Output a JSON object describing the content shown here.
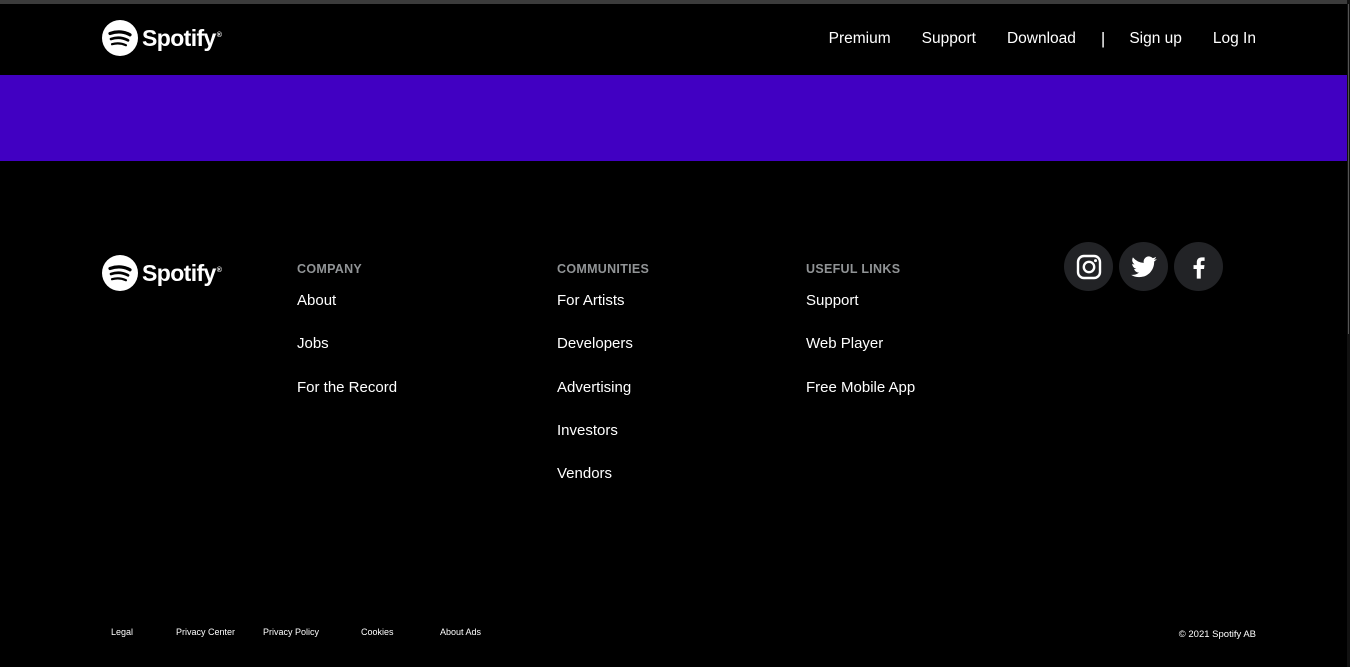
{
  "brand": {
    "name": "Spotify",
    "tm": "®"
  },
  "nav": {
    "links": [
      "Premium",
      "Support",
      "Download"
    ],
    "divider": "|",
    "signup": "Sign up",
    "login": "Log In"
  },
  "banner": {
    "color": "#4100c2"
  },
  "footer": {
    "company": {
      "heading": "COMPANY",
      "links": [
        "About",
        "Jobs",
        "For the Record"
      ]
    },
    "communities": {
      "heading": "COMMUNITIES",
      "links": [
        "For Artists",
        "Developers",
        "Advertising",
        "Investors",
        "Vendors"
      ]
    },
    "useful": {
      "heading": "USEFUL LINKS",
      "links": [
        "Support",
        "Web Player",
        "Free Mobile App"
      ]
    },
    "socials": [
      "instagram-icon",
      "twitter-icon",
      "facebook-icon"
    ],
    "legal_links": [
      "Legal",
      "Privacy Center",
      "Privacy Policy",
      "Cookies",
      "About Ads"
    ],
    "copyright": "© 2021 Spotify AB"
  }
}
